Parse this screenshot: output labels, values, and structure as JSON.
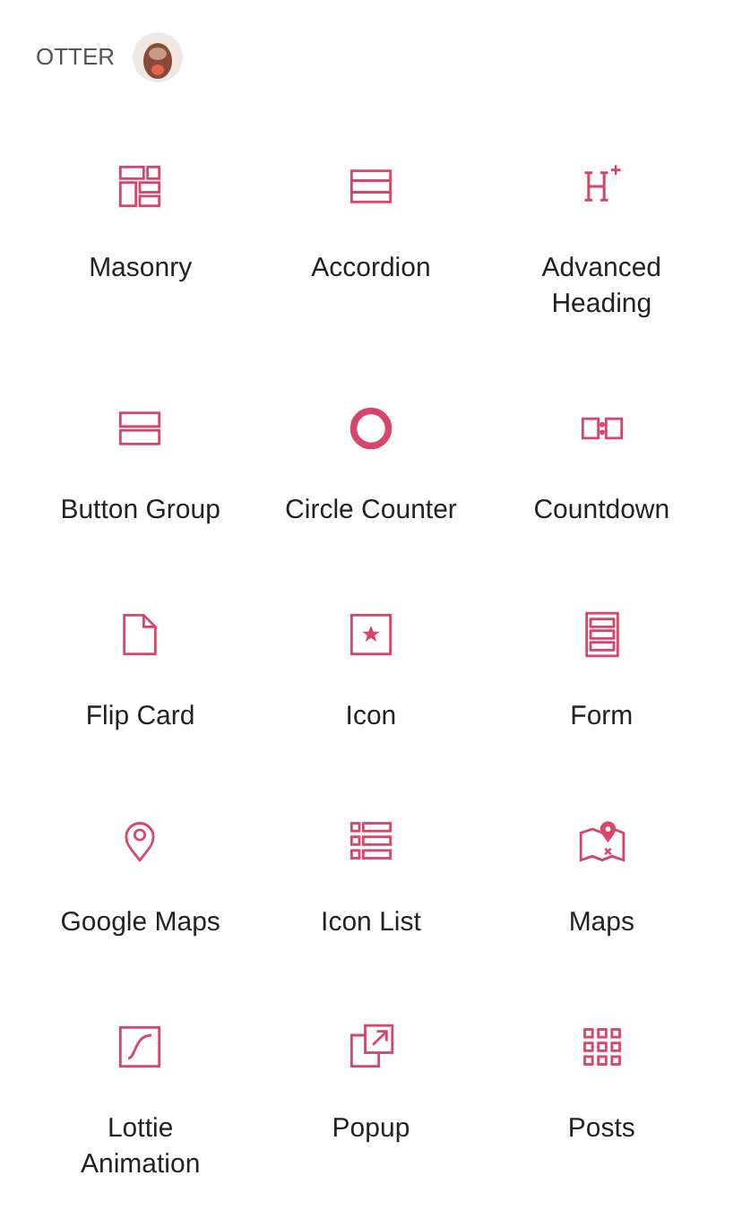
{
  "category": {
    "title": "OTTER"
  },
  "blocks": [
    {
      "kind": "masonry",
      "label": "Masonry"
    },
    {
      "kind": "accordion",
      "label": "Accordion"
    },
    {
      "kind": "heading",
      "label": "Advanced Heading"
    },
    {
      "kind": "buttons",
      "label": "Button Group"
    },
    {
      "kind": "circle",
      "label": "Circle Counter"
    },
    {
      "kind": "countdown",
      "label": "Countdown"
    },
    {
      "kind": "flip",
      "label": "Flip Card"
    },
    {
      "kind": "icon",
      "label": "Icon"
    },
    {
      "kind": "form",
      "label": "Form"
    },
    {
      "kind": "pin",
      "label": "Google Maps"
    },
    {
      "kind": "iconlist",
      "label": "Icon List"
    },
    {
      "kind": "maps",
      "label": "Maps"
    },
    {
      "kind": "lottie",
      "label": "Lottie Animation"
    },
    {
      "kind": "popup",
      "label": "Popup"
    },
    {
      "kind": "posts",
      "label": "Posts"
    }
  ]
}
